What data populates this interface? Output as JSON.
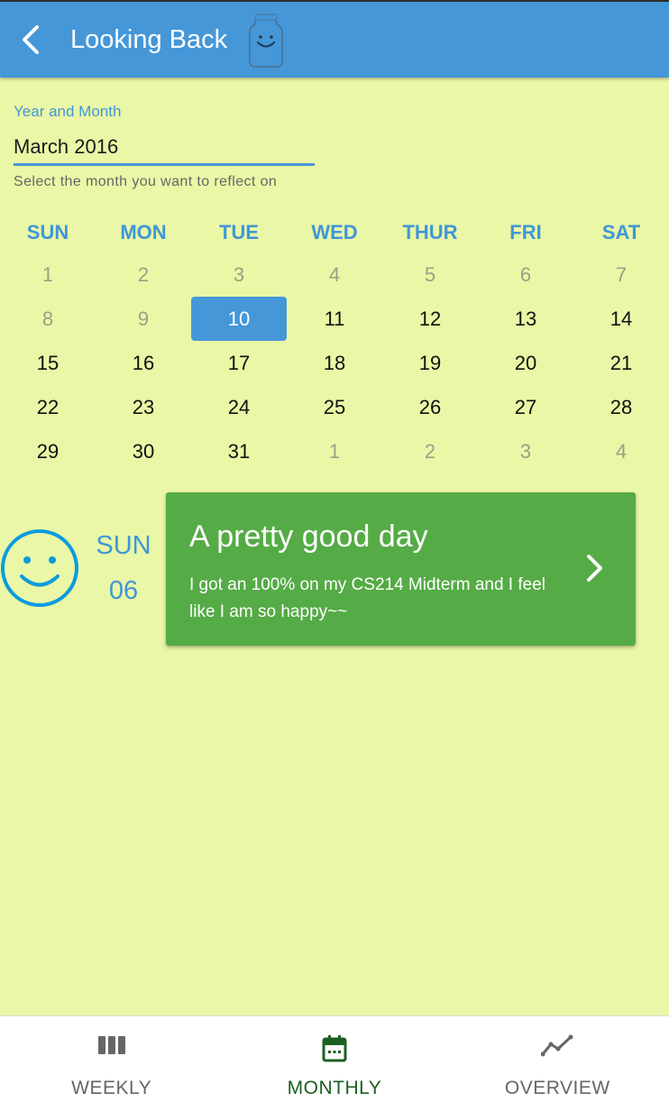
{
  "appbar": {
    "title": "Looking Back",
    "back_icon": "chevron-left-icon",
    "logo_icon": "smiley-jar-logo",
    "color": "#4597d8"
  },
  "month_field": {
    "label": "Year and Month",
    "value": "March 2016",
    "helper": "Select the month you want to reflect on"
  },
  "calendar": {
    "weekdays": [
      "SUN",
      "MON",
      "TUE",
      "WED",
      "THUR",
      "FRI",
      "SAT"
    ],
    "selected_day": "10",
    "weeks": [
      [
        {
          "d": "1",
          "muted": true
        },
        {
          "d": "2",
          "muted": true
        },
        {
          "d": "3",
          "muted": true
        },
        {
          "d": "4",
          "muted": true
        },
        {
          "d": "5",
          "muted": true
        },
        {
          "d": "6",
          "muted": true
        },
        {
          "d": "7",
          "muted": true
        }
      ],
      [
        {
          "d": "8",
          "muted": true
        },
        {
          "d": "9",
          "muted": true
        },
        {
          "d": "10",
          "selected": true
        },
        {
          "d": "11"
        },
        {
          "d": "12"
        },
        {
          "d": "13"
        },
        {
          "d": "14"
        }
      ],
      [
        {
          "d": "15"
        },
        {
          "d": "16"
        },
        {
          "d": "17"
        },
        {
          "d": "18"
        },
        {
          "d": "19"
        },
        {
          "d": "20"
        },
        {
          "d": "21"
        }
      ],
      [
        {
          "d": "22"
        },
        {
          "d": "23"
        },
        {
          "d": "24"
        },
        {
          "d": "25"
        },
        {
          "d": "26"
        },
        {
          "d": "27"
        },
        {
          "d": "28"
        }
      ],
      [
        {
          "d": "29"
        },
        {
          "d": "30"
        },
        {
          "d": "31"
        },
        {
          "d": "1",
          "muted": true
        },
        {
          "d": "2",
          "muted": true
        },
        {
          "d": "3",
          "muted": true
        },
        {
          "d": "4",
          "muted": true
        }
      ]
    ]
  },
  "entry": {
    "mood_icon": "smiley-face-icon",
    "weekday": "SUN",
    "date": "06",
    "title": "A pretty good day",
    "text": "I got an 100% on my CS214 Midterm and I feel like I am so happy~~",
    "chevron_icon": "chevron-right-icon",
    "card_color": "#55ab46"
  },
  "bottom_nav": {
    "items": [
      {
        "label": "WEEKLY",
        "icon": "view-week-icon",
        "active": false
      },
      {
        "label": "MONTHLY",
        "icon": "calendar-icon",
        "active": true
      },
      {
        "label": "OVERVIEW",
        "icon": "trend-line-icon",
        "active": false
      }
    ],
    "active_color": "#1d5f23"
  }
}
